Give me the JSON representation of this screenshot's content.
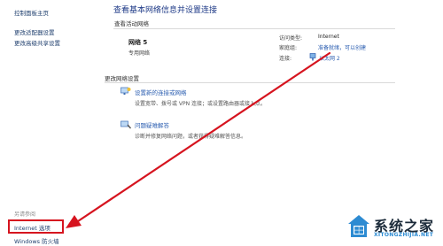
{
  "sidebar": {
    "home_link": "控制面板主页",
    "adapter_settings": "更改适配器设置",
    "advanced_sharing": "更改高级共享设置",
    "see_also": "另请参阅",
    "internet_options": "Internet 选项",
    "windows_firewall": "Windows 防火墙"
  },
  "main": {
    "title": "查看基本网络信息并设置连接",
    "active_networks_label": "查看活动网络",
    "network": {
      "name": "网络 5",
      "type": "专用网络",
      "access_type_label": "访问类型:",
      "access_type_value": "Internet",
      "homegroup_label": "家庭组:",
      "homegroup_value": "准备就绪，可以创建",
      "connections_label": "连接:",
      "connections_value": "以太网 2"
    },
    "change_settings_label": "更改网络设置",
    "tasks": [
      {
        "link": "设置新的连接或网络",
        "desc": "设置宽带、拨号或 VPN 连接；或设置路由器或接入点。"
      },
      {
        "link": "问题疑难解答",
        "desc": "诊断并修复网络问题，或者获得疑难解答信息。"
      }
    ]
  },
  "watermark": {
    "title": "系统之家",
    "subtitle": "XITONGZHIJIA.NET"
  },
  "colors": {
    "link": "#2a5db0",
    "title": "#1e3a87",
    "highlight": "#d6141f"
  }
}
